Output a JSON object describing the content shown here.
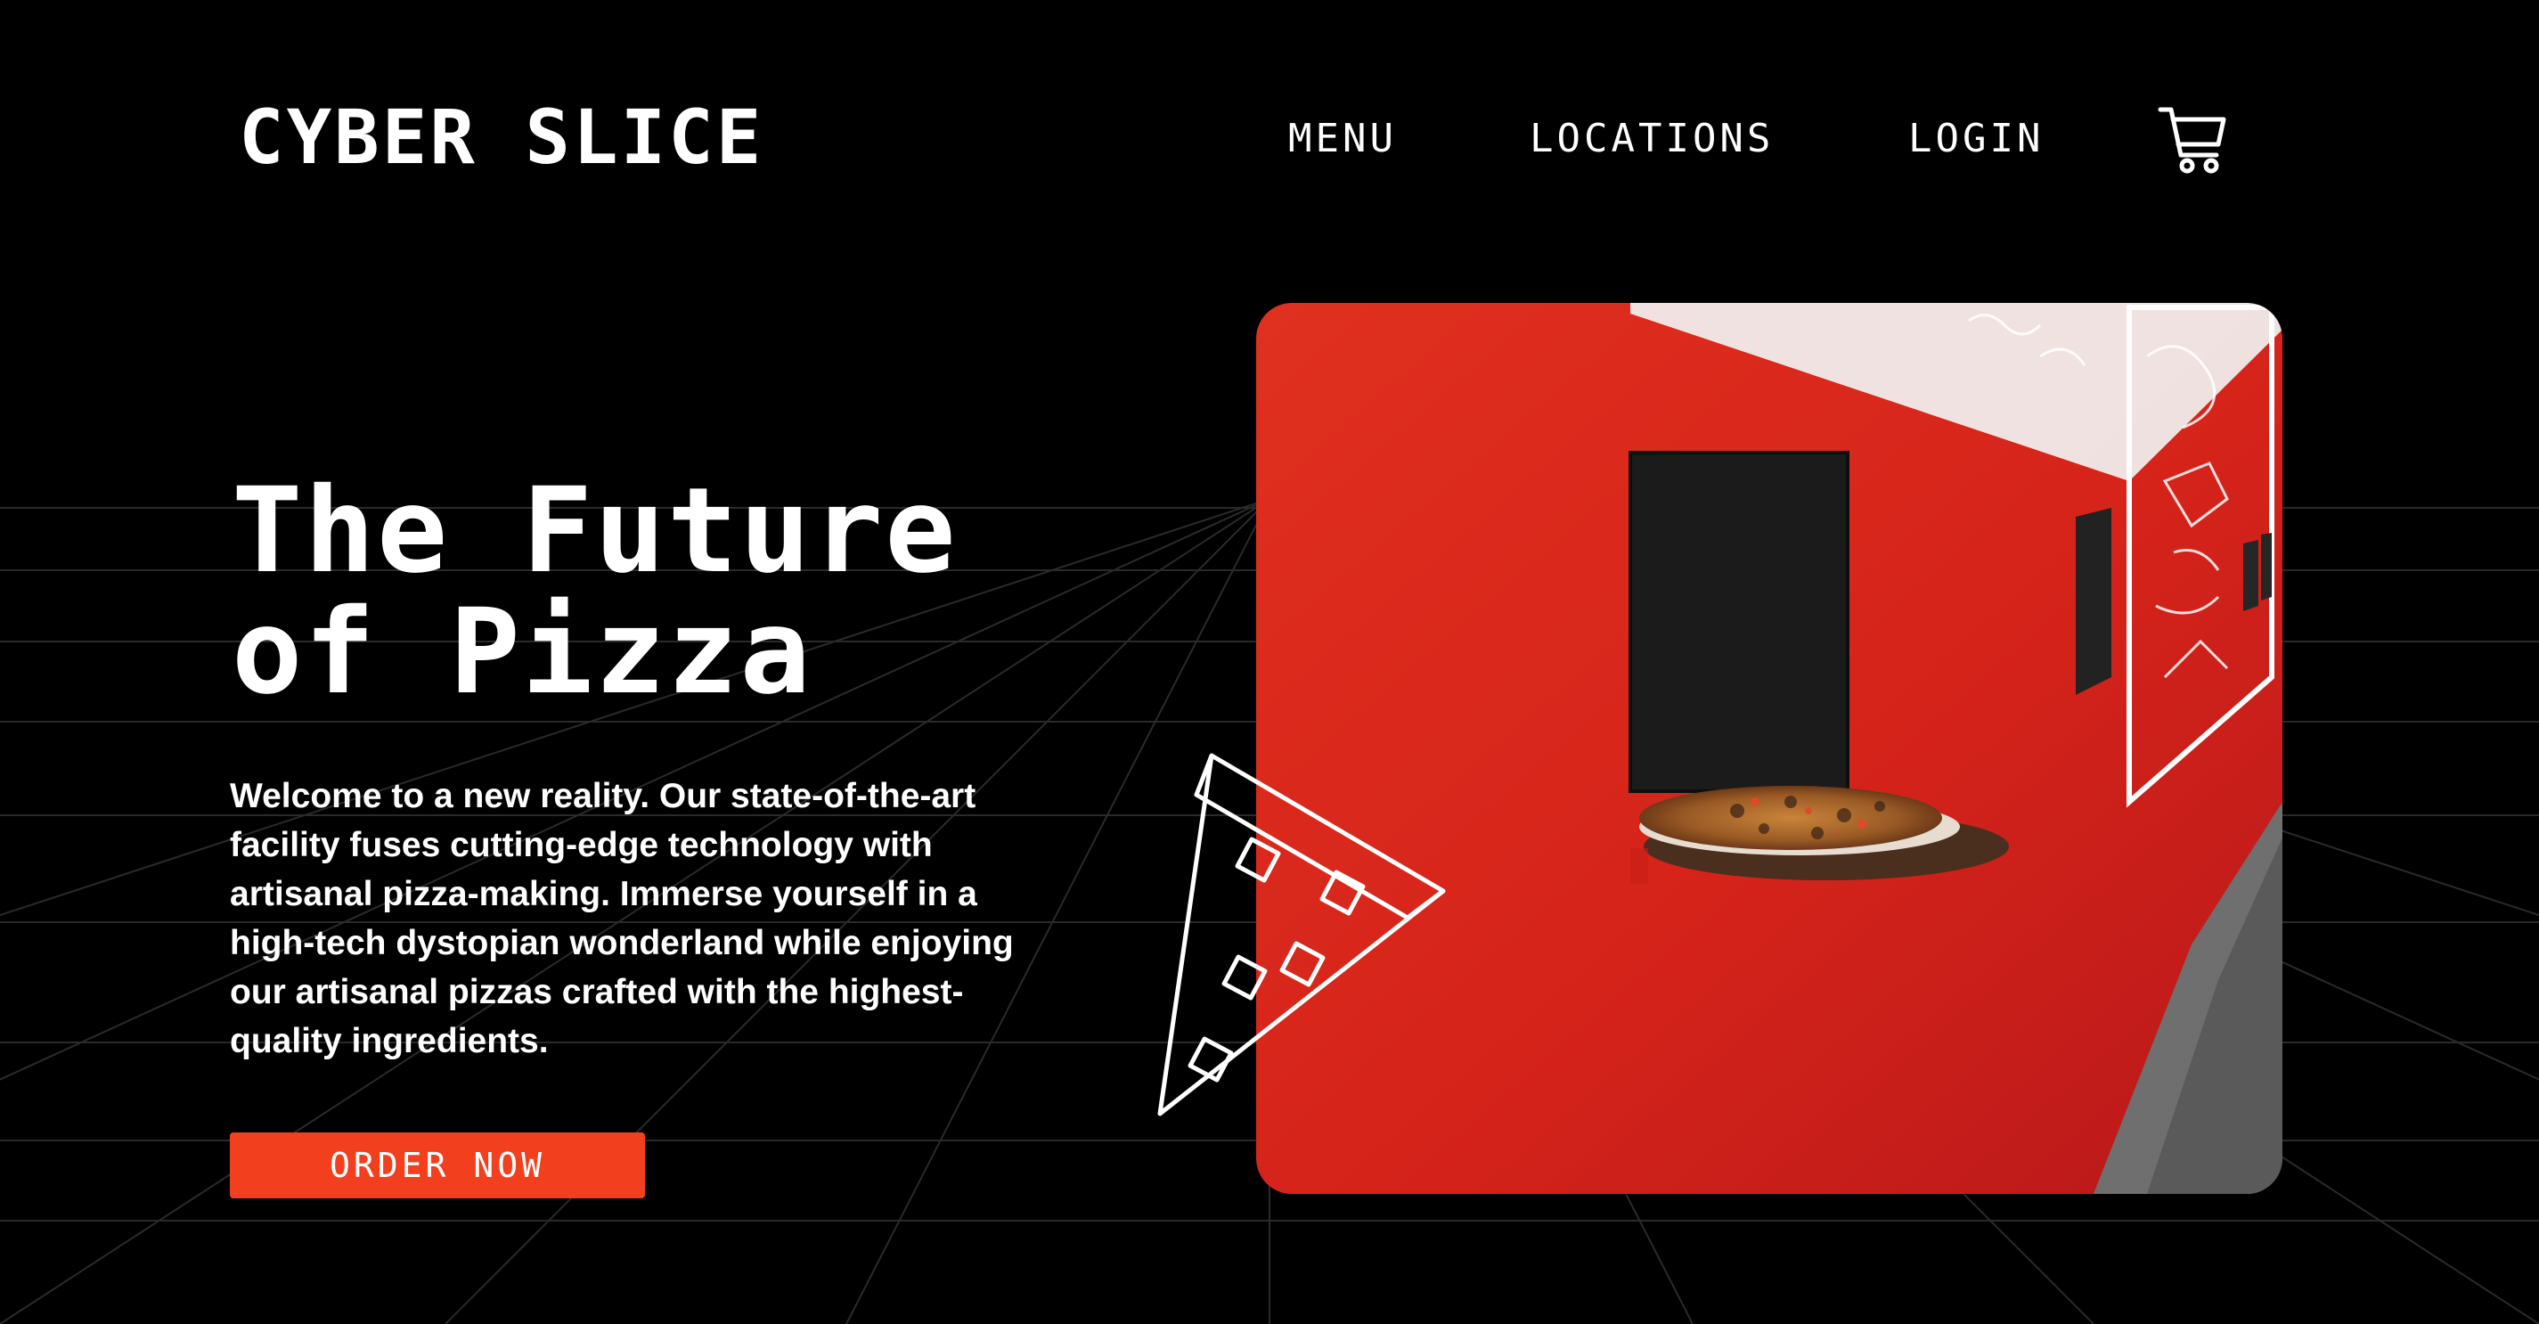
{
  "brand": {
    "name": "CYBER SLICE"
  },
  "nav": {
    "items": [
      {
        "label": "MENU"
      },
      {
        "label": "LOCATIONS"
      },
      {
        "label": "LOGIN"
      }
    ],
    "cart_icon": "cart-icon"
  },
  "hero": {
    "title_line1": "The Future",
    "title_line2": "of Pizza",
    "body": "Welcome to a new reality. Our state-of-the-art facility fuses cutting-edge technology with artisanal pizza-making. Immerse yourself in a high-tech dystopian wonderland while enjoying our artisanal pizzas crafted with the highest-quality ingredients.",
    "cta_label": "ORDER NOW",
    "image_icon": "pizza-window-photo",
    "decoration_icon": "pizza-slice-outline-icon"
  },
  "colors": {
    "background": "#000000",
    "accent": "#f2401f",
    "text": "#ffffff",
    "wall_red": "#d9261c"
  }
}
